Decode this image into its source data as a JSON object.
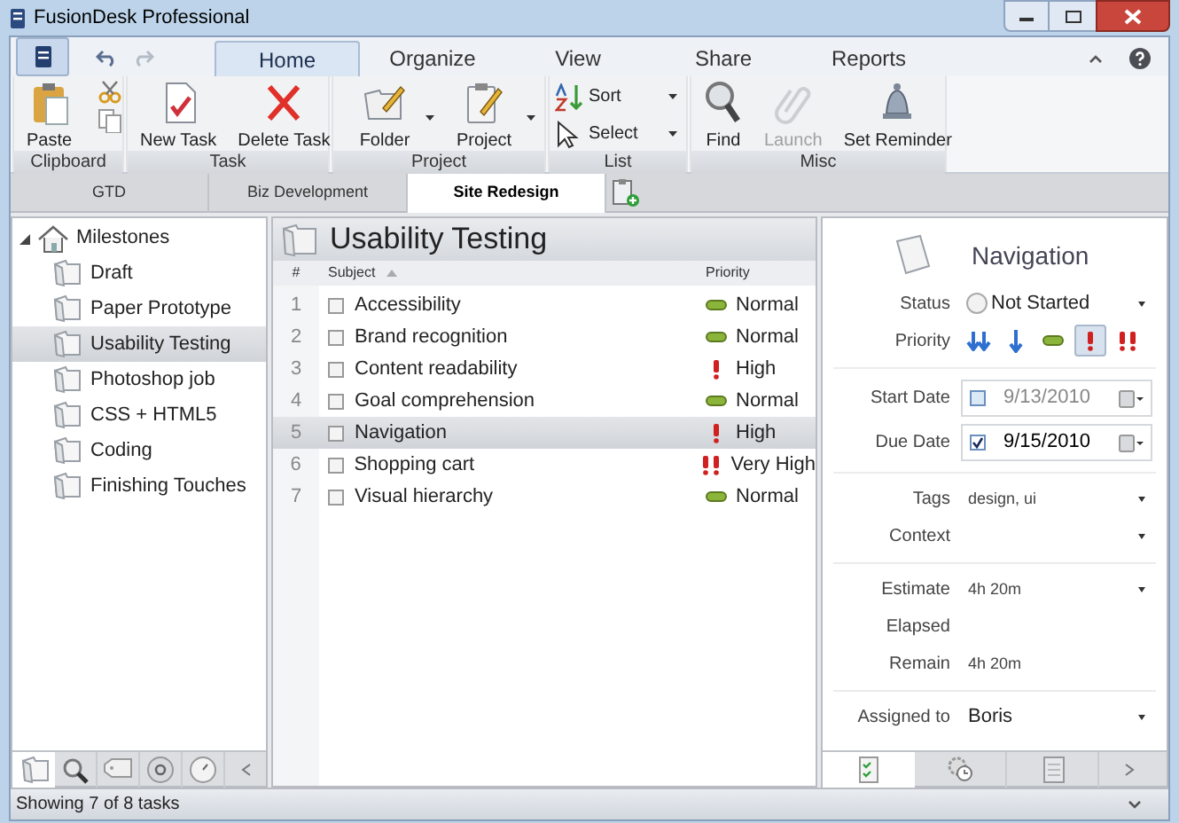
{
  "window": {
    "title": "FusionDesk Professional"
  },
  "ribbon_tabs": [
    {
      "label": "Home",
      "selected": true
    },
    {
      "label": "Organize",
      "selected": false
    },
    {
      "label": "View",
      "selected": false
    },
    {
      "label": "Share",
      "selected": false
    },
    {
      "label": "Reports",
      "selected": false
    }
  ],
  "ribbon_groups": [
    {
      "label": "Clipboard",
      "buttons": [
        {
          "label": "Paste",
          "disabled": false,
          "dropdown": false
        }
      ]
    },
    {
      "label": "Task",
      "buttons": [
        {
          "label": "New Task",
          "disabled": false,
          "dropdown": false
        },
        {
          "label": "Delete Task",
          "disabled": false,
          "dropdown": false
        }
      ]
    },
    {
      "label": "Project",
      "buttons": [
        {
          "label": "Folder",
          "disabled": false,
          "dropdown": true
        },
        {
          "label": "Project",
          "disabled": false,
          "dropdown": true
        }
      ]
    },
    {
      "label": "List",
      "buttons": [
        {
          "label": "Sort",
          "disabled": false,
          "dropdown": true
        },
        {
          "label": "Select",
          "disabled": false,
          "dropdown": true
        }
      ]
    },
    {
      "label": "Misc",
      "buttons": [
        {
          "label": "Find",
          "disabled": false,
          "dropdown": false
        },
        {
          "label": "Launch",
          "disabled": true,
          "dropdown": false
        },
        {
          "label": "Set Reminder",
          "disabled": false,
          "dropdown": false
        }
      ]
    }
  ],
  "document_tabs": [
    {
      "label": "GTD",
      "selected": false
    },
    {
      "label": "Biz Development",
      "selected": false
    },
    {
      "label": "Site Redesign",
      "selected": true
    }
  ],
  "sidebar": {
    "tree": [
      {
        "label": "Milestones",
        "expanded": true,
        "selected": false,
        "children": [
          {
            "label": "Draft",
            "selected": false
          },
          {
            "label": "Paper Prototype",
            "selected": false
          },
          {
            "label": "Usability Testing",
            "selected": true
          },
          {
            "label": "Photoshop job",
            "selected": false
          },
          {
            "label": "CSS + HTML5",
            "selected": false
          },
          {
            "label": "Coding",
            "selected": false
          },
          {
            "label": "Finishing Touches",
            "selected": false
          }
        ]
      }
    ],
    "bottom_tabs": [
      {
        "selected": true
      },
      {
        "selected": false
      },
      {
        "selected": false
      },
      {
        "selected": false
      },
      {
        "selected": false
      }
    ]
  },
  "task_list": {
    "title": "Usability Testing",
    "columns": [
      "#",
      "Subject",
      "Priority"
    ],
    "rows": [
      {
        "number": "1",
        "subject": "Accessibility",
        "checked": false,
        "priority": {
          "label": "Normal",
          "kind": "normal"
        },
        "selected": false
      },
      {
        "number": "2",
        "subject": "Brand recognition",
        "checked": false,
        "priority": {
          "label": "Normal",
          "kind": "normal"
        },
        "selected": false
      },
      {
        "number": "3",
        "subject": "Content readability",
        "checked": false,
        "priority": {
          "label": "High",
          "kind": "high"
        },
        "selected": false
      },
      {
        "number": "4",
        "subject": "Goal comprehension",
        "checked": false,
        "priority": {
          "label": "Normal",
          "kind": "normal"
        },
        "selected": false
      },
      {
        "number": "5",
        "subject": "Navigation",
        "checked": false,
        "priority": {
          "label": "High",
          "kind": "high"
        },
        "selected": true
      },
      {
        "number": "6",
        "subject": "Shopping cart",
        "checked": false,
        "priority": {
          "label": "Very High",
          "kind": "very_high"
        },
        "selected": false
      },
      {
        "number": "7",
        "subject": "Visual hierarchy",
        "checked": false,
        "priority": {
          "label": "Normal",
          "kind": "normal"
        },
        "selected": false
      }
    ]
  },
  "details": {
    "title": "Navigation",
    "status": {
      "label": "Status",
      "value": "Not Started"
    },
    "priority": {
      "label": "Priority",
      "options": [
        {
          "kind": "lowest",
          "selected": false
        },
        {
          "kind": "low",
          "selected": false
        },
        {
          "kind": "normal",
          "selected": false
        },
        {
          "kind": "high",
          "selected": true
        },
        {
          "kind": "very_high",
          "selected": false
        }
      ]
    },
    "start_date": {
      "label": "Start Date",
      "value": "9/13/2010",
      "checked": false
    },
    "due_date": {
      "label": "Due Date",
      "value": "9/15/2010",
      "checked": true
    },
    "tags": {
      "label": "Tags",
      "value": "design, ui"
    },
    "context": {
      "label": "Context"
    },
    "estimate": {
      "label": "Estimate",
      "value": "4h 20m"
    },
    "elapsed": {
      "label": "Elapsed"
    },
    "remain": {
      "label": "Remain",
      "value": "4h 20m"
    },
    "assigned_to": {
      "label": "Assigned to",
      "value": "Boris"
    },
    "bottom_tabs": [
      {
        "selected": true
      },
      {
        "selected": false
      },
      {
        "selected": false
      }
    ]
  },
  "status_bar": {
    "text": "Showing 7 of 8 tasks"
  }
}
